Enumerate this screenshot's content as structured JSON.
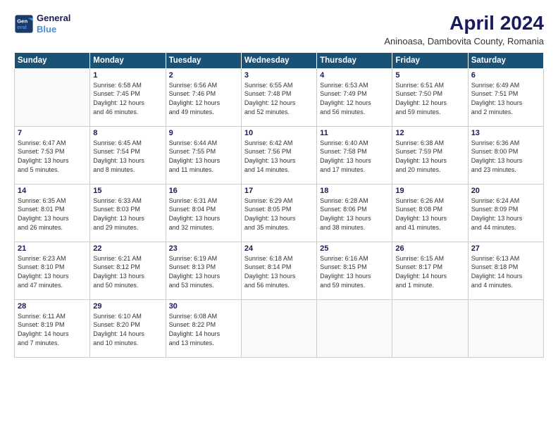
{
  "logo": {
    "line1": "General",
    "line2": "Blue"
  },
  "title": "April 2024",
  "subtitle": "Aninoasa, Dambovita County, Romania",
  "weekdays": [
    "Sunday",
    "Monday",
    "Tuesday",
    "Wednesday",
    "Thursday",
    "Friday",
    "Saturday"
  ],
  "weeks": [
    [
      {
        "day": "",
        "info": ""
      },
      {
        "day": "1",
        "info": "Sunrise: 6:58 AM\nSunset: 7:45 PM\nDaylight: 12 hours\nand 46 minutes."
      },
      {
        "day": "2",
        "info": "Sunrise: 6:56 AM\nSunset: 7:46 PM\nDaylight: 12 hours\nand 49 minutes."
      },
      {
        "day": "3",
        "info": "Sunrise: 6:55 AM\nSunset: 7:48 PM\nDaylight: 12 hours\nand 52 minutes."
      },
      {
        "day": "4",
        "info": "Sunrise: 6:53 AM\nSunset: 7:49 PM\nDaylight: 12 hours\nand 56 minutes."
      },
      {
        "day": "5",
        "info": "Sunrise: 6:51 AM\nSunset: 7:50 PM\nDaylight: 12 hours\nand 59 minutes."
      },
      {
        "day": "6",
        "info": "Sunrise: 6:49 AM\nSunset: 7:51 PM\nDaylight: 13 hours\nand 2 minutes."
      }
    ],
    [
      {
        "day": "7",
        "info": "Sunrise: 6:47 AM\nSunset: 7:53 PM\nDaylight: 13 hours\nand 5 minutes."
      },
      {
        "day": "8",
        "info": "Sunrise: 6:45 AM\nSunset: 7:54 PM\nDaylight: 13 hours\nand 8 minutes."
      },
      {
        "day": "9",
        "info": "Sunrise: 6:44 AM\nSunset: 7:55 PM\nDaylight: 13 hours\nand 11 minutes."
      },
      {
        "day": "10",
        "info": "Sunrise: 6:42 AM\nSunset: 7:56 PM\nDaylight: 13 hours\nand 14 minutes."
      },
      {
        "day": "11",
        "info": "Sunrise: 6:40 AM\nSunset: 7:58 PM\nDaylight: 13 hours\nand 17 minutes."
      },
      {
        "day": "12",
        "info": "Sunrise: 6:38 AM\nSunset: 7:59 PM\nDaylight: 13 hours\nand 20 minutes."
      },
      {
        "day": "13",
        "info": "Sunrise: 6:36 AM\nSunset: 8:00 PM\nDaylight: 13 hours\nand 23 minutes."
      }
    ],
    [
      {
        "day": "14",
        "info": "Sunrise: 6:35 AM\nSunset: 8:01 PM\nDaylight: 13 hours\nand 26 minutes."
      },
      {
        "day": "15",
        "info": "Sunrise: 6:33 AM\nSunset: 8:03 PM\nDaylight: 13 hours\nand 29 minutes."
      },
      {
        "day": "16",
        "info": "Sunrise: 6:31 AM\nSunset: 8:04 PM\nDaylight: 13 hours\nand 32 minutes."
      },
      {
        "day": "17",
        "info": "Sunrise: 6:29 AM\nSunset: 8:05 PM\nDaylight: 13 hours\nand 35 minutes."
      },
      {
        "day": "18",
        "info": "Sunrise: 6:28 AM\nSunset: 8:06 PM\nDaylight: 13 hours\nand 38 minutes."
      },
      {
        "day": "19",
        "info": "Sunrise: 6:26 AM\nSunset: 8:08 PM\nDaylight: 13 hours\nand 41 minutes."
      },
      {
        "day": "20",
        "info": "Sunrise: 6:24 AM\nSunset: 8:09 PM\nDaylight: 13 hours\nand 44 minutes."
      }
    ],
    [
      {
        "day": "21",
        "info": "Sunrise: 6:23 AM\nSunset: 8:10 PM\nDaylight: 13 hours\nand 47 minutes."
      },
      {
        "day": "22",
        "info": "Sunrise: 6:21 AM\nSunset: 8:12 PM\nDaylight: 13 hours\nand 50 minutes."
      },
      {
        "day": "23",
        "info": "Sunrise: 6:19 AM\nSunset: 8:13 PM\nDaylight: 13 hours\nand 53 minutes."
      },
      {
        "day": "24",
        "info": "Sunrise: 6:18 AM\nSunset: 8:14 PM\nDaylight: 13 hours\nand 56 minutes."
      },
      {
        "day": "25",
        "info": "Sunrise: 6:16 AM\nSunset: 8:15 PM\nDaylight: 13 hours\nand 59 minutes."
      },
      {
        "day": "26",
        "info": "Sunrise: 6:15 AM\nSunset: 8:17 PM\nDaylight: 14 hours\nand 1 minute."
      },
      {
        "day": "27",
        "info": "Sunrise: 6:13 AM\nSunset: 8:18 PM\nDaylight: 14 hours\nand 4 minutes."
      }
    ],
    [
      {
        "day": "28",
        "info": "Sunrise: 6:11 AM\nSunset: 8:19 PM\nDaylight: 14 hours\nand 7 minutes."
      },
      {
        "day": "29",
        "info": "Sunrise: 6:10 AM\nSunset: 8:20 PM\nDaylight: 14 hours\nand 10 minutes."
      },
      {
        "day": "30",
        "info": "Sunrise: 6:08 AM\nSunset: 8:22 PM\nDaylight: 14 hours\nand 13 minutes."
      },
      {
        "day": "",
        "info": ""
      },
      {
        "day": "",
        "info": ""
      },
      {
        "day": "",
        "info": ""
      },
      {
        "day": "",
        "info": ""
      }
    ]
  ]
}
